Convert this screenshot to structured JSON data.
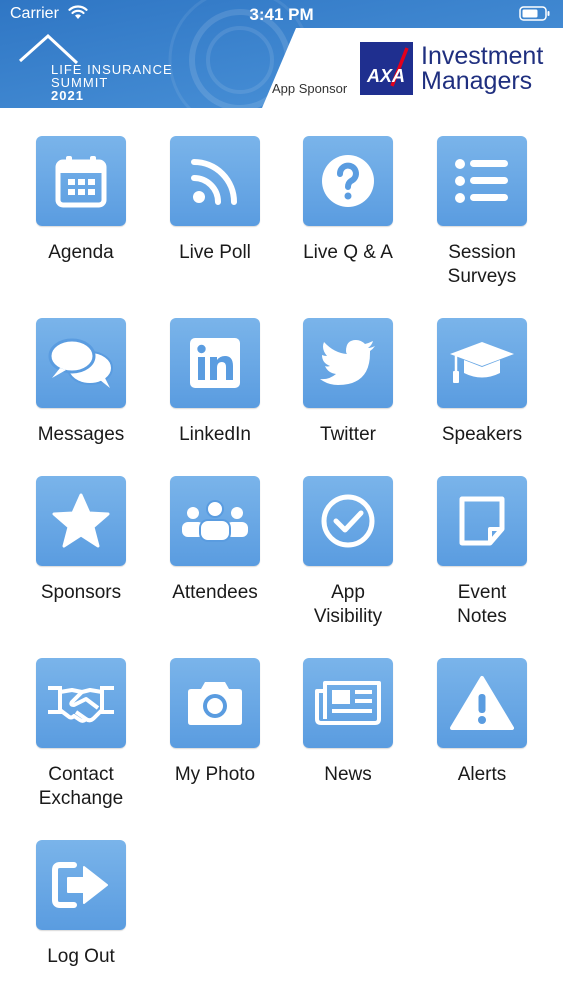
{
  "status_bar": {
    "carrier": "Carrier",
    "time": "3:41 PM"
  },
  "banner": {
    "event_line1": "LIFE INSURANCE",
    "event_line2": "SUMMIT",
    "event_year": "2021",
    "sponsor_label": "App Sponsor",
    "sponsor_logo_text": "AXA",
    "sponsor_name_line1": "Investment",
    "sponsor_name_line2": "Managers"
  },
  "colors": {
    "tile_top": "#7ab4ea",
    "tile_bottom": "#5a9ce0",
    "banner_blue": "#3d86cf",
    "sponsor_navy": "#1f2f7f",
    "axa_red": "#e3001b"
  },
  "menu": [
    {
      "line1": "Agenda",
      "line2": "",
      "icon": "calendar-icon"
    },
    {
      "line1": "Live Poll",
      "line2": "",
      "icon": "rss-icon"
    },
    {
      "line1": "Live Q & A",
      "line2": "",
      "icon": "question-icon"
    },
    {
      "line1": "Session",
      "line2": "Surveys",
      "icon": "list-icon"
    },
    {
      "line1": "Messages",
      "line2": "",
      "icon": "chat-bubbles-icon"
    },
    {
      "line1": "LinkedIn",
      "line2": "",
      "icon": "linkedin-icon"
    },
    {
      "line1": "Twitter",
      "line2": "",
      "icon": "twitter-icon"
    },
    {
      "line1": "Speakers",
      "line2": "",
      "icon": "graduation-cap-icon"
    },
    {
      "line1": "Sponsors",
      "line2": "",
      "icon": "star-icon"
    },
    {
      "line1": "Attendees",
      "line2": "",
      "icon": "people-icon"
    },
    {
      "line1": "App",
      "line2": "Visibility",
      "icon": "check-circle-icon"
    },
    {
      "line1": "Event",
      "line2": "Notes",
      "icon": "note-icon"
    },
    {
      "line1": "Contact",
      "line2": "Exchange",
      "icon": "handshake-icon"
    },
    {
      "line1": "My Photo",
      "line2": "",
      "icon": "camera-icon"
    },
    {
      "line1": "News",
      "line2": "",
      "icon": "newspaper-icon"
    },
    {
      "line1": "Alerts",
      "line2": "",
      "icon": "warning-icon"
    },
    {
      "line1": "Log Out",
      "line2": "",
      "icon": "logout-icon"
    }
  ]
}
